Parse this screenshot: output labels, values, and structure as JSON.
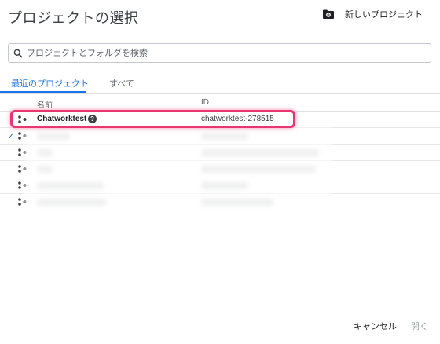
{
  "dialog": {
    "title": "プロジェクトの選択",
    "new_project_label": "新しいプロジェクト",
    "new_project_icon": "folder-settings-icon"
  },
  "search": {
    "placeholder": "プロジェクトとフォルダを検索",
    "value": ""
  },
  "tabs": [
    {
      "label": "最近のプロジェクト",
      "active": true
    },
    {
      "label": "すべて",
      "active": false
    }
  ],
  "table": {
    "columns": [
      "名前",
      "ID"
    ],
    "rows": [
      {
        "name": "Chatworktest",
        "id": "chatworktest-278515",
        "selected": false,
        "highlighted": true,
        "blurred": false
      },
      {
        "name": "",
        "id": "",
        "selected": true,
        "highlighted": false,
        "blurred": true
      },
      {
        "name": "",
        "id": "",
        "selected": false,
        "highlighted": false,
        "blurred": true
      },
      {
        "name": "",
        "id": "",
        "selected": false,
        "highlighted": false,
        "blurred": true
      },
      {
        "name": "",
        "id": "",
        "selected": false,
        "highlighted": false,
        "blurred": true
      },
      {
        "name": "",
        "id": "",
        "selected": false,
        "highlighted": false,
        "blurred": true
      }
    ]
  },
  "footer": {
    "cancel_label": "キャンセル",
    "open_label": "開く"
  },
  "colors": {
    "accent": "#1a73e8",
    "highlight": "#e8366f"
  }
}
